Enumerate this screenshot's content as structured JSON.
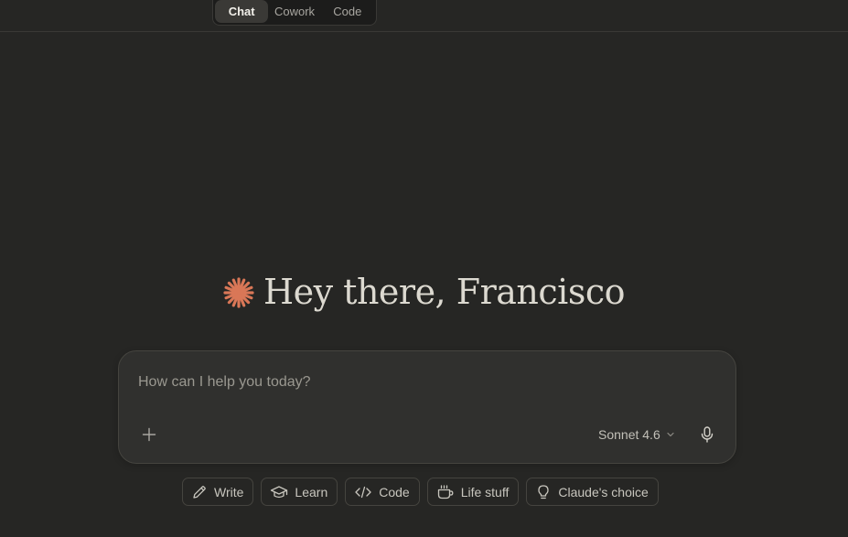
{
  "mode_tabs": [
    {
      "label": "Chat",
      "active": true
    },
    {
      "label": "Cowork",
      "active": false
    },
    {
      "label": "Code",
      "active": false
    }
  ],
  "greeting": {
    "text": "Hey there, Francisco",
    "icon": "claude-spark-icon",
    "icon_color": "#d97757"
  },
  "composer": {
    "placeholder": "How can I help you today?",
    "value": "",
    "model_label": "Sonnet 4.6"
  },
  "chips": [
    {
      "label": "Write",
      "icon": "pencil-icon"
    },
    {
      "label": "Learn",
      "icon": "graduation-cap-icon"
    },
    {
      "label": "Code",
      "icon": "code-icon"
    },
    {
      "label": "Life stuff",
      "icon": "coffee-cup-icon"
    },
    {
      "label": "Claude's choice",
      "icon": "lightbulb-icon"
    }
  ],
  "colors": {
    "background": "#262624",
    "accent": "#d97757"
  }
}
